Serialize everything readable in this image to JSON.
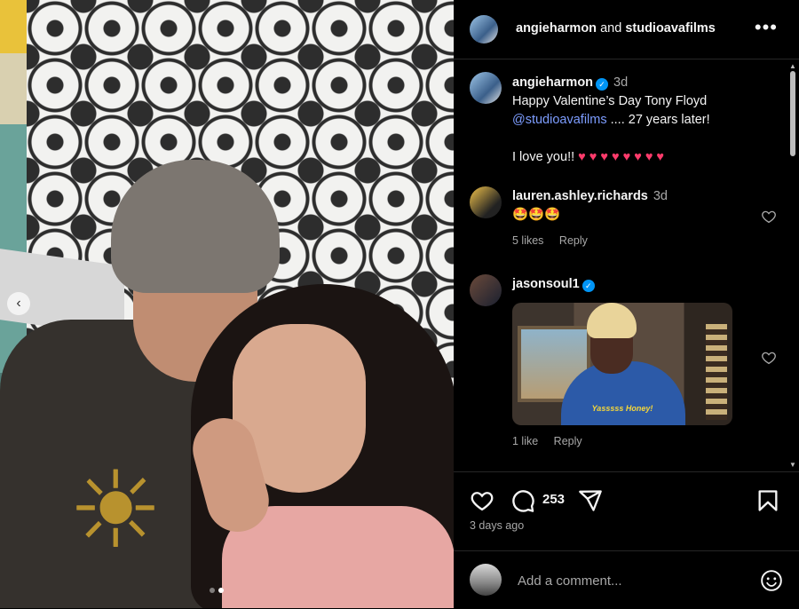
{
  "header": {
    "user1": "angieharmon",
    "and_text": "and",
    "user2": "studioavafilms",
    "more_label": "•••"
  },
  "caption": {
    "username": "angieharmon",
    "verified_mark": "✓",
    "time": "3d",
    "line1": "Happy Valentine’s Day Tony Floyd",
    "mention": "@studioavafilms",
    "line2_rest": " .... 27 years later!",
    "line3": "I love you!!",
    "hearts": "♥♥♥♥♥♥♥♥"
  },
  "comments": [
    {
      "username": "lauren.ashley.richards",
      "time": "3d",
      "text": "🤩🤩🤩",
      "likes": "5 likes",
      "reply": "Reply"
    },
    {
      "username": "jasonsoul1",
      "verified_mark": "✓",
      "gif_caption": "Yasssss Honey!",
      "likes": "1 like",
      "reply": "Reply"
    }
  ],
  "actions": {
    "comment_count": "253",
    "posted": "3 days ago"
  },
  "add_comment": {
    "placeholder": "Add a comment..."
  },
  "carousel": {
    "prev_label": "‹",
    "current_slide": 2,
    "total_slides": 2
  },
  "icons": [
    "heart-icon",
    "comment-icon",
    "share-icon",
    "bookmark-icon",
    "emoji-icon",
    "more-icon",
    "verified-icon"
  ],
  "colors": {
    "background": "#000000",
    "link": "#7d9dff",
    "verified": "#0095f6",
    "muted": "#a8a8a8"
  }
}
